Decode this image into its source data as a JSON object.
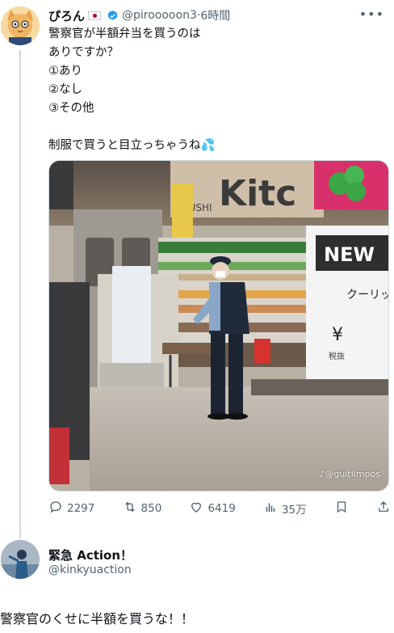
{
  "tweet": {
    "display_name": "ぴろん",
    "flag_icon": "japan-flag-icon",
    "verified_icon": "verified-badge-icon",
    "handle": "@pirooooon3",
    "separator": "·",
    "time": "6時間",
    "more_icon": "more-icon",
    "text": "警察官が半額弁当を買うのは\nありですか？\n①あり\n②なし\n③その他\n\n制服で買うと目立っちゃうね💦",
    "media": {
      "sign_kitchen": "Kitc",
      "sign_new": "NEW",
      "sign_price_label": "クーリッ",
      "sign_yen": "¥",
      "sign_tax": "税抜",
      "sign_sushi": "SUSHI",
      "watermark": "♪@guitiimpos"
    },
    "actions": {
      "replies": "2297",
      "retweets": "850",
      "likes": "6419",
      "views": "35万"
    }
  },
  "reply": {
    "display_name": "緊急 Action！",
    "handle": "@kinkyuaction",
    "text": "警察官のくせに半額を買うな！！"
  }
}
